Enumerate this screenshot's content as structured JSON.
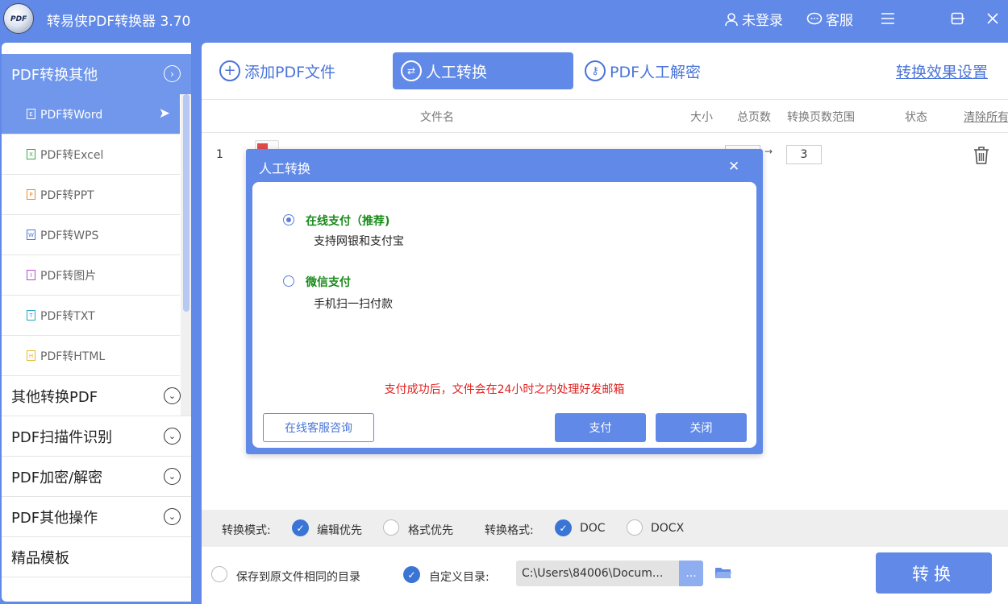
{
  "app": {
    "title": "转易侠PDF转换器 3.70",
    "logo_text": "PDF"
  },
  "titlebar": {
    "user_label": "未登录",
    "service_label": "客服"
  },
  "sidebar": {
    "header": "PDF转换其他",
    "sub_items": [
      {
        "label": "PDF转Word",
        "icon_color": "#6189e8",
        "icon_char": "E"
      },
      {
        "label": "PDF转Excel",
        "icon_color": "#3aa64a",
        "icon_char": "X"
      },
      {
        "label": "PDF转PPT",
        "icon_color": "#e88a2b",
        "icon_char": "P"
      },
      {
        "label": "PDF转WPS",
        "icon_color": "#4a74d8",
        "icon_char": "W"
      },
      {
        "label": "PDF转图片",
        "icon_color": "#b04fc4",
        "icon_char": "I"
      },
      {
        "label": "PDF转TXT",
        "icon_color": "#2aa3c8",
        "icon_char": "T"
      },
      {
        "label": "PDF转HTML",
        "icon_color": "#e8b830",
        "icon_char": "H"
      }
    ],
    "categories": [
      "其他转换PDF",
      "PDF扫描件识别",
      "PDF加密/解密",
      "PDF其他操作",
      "精品模板"
    ]
  },
  "toolbar": {
    "add_pdf": "添加PDF文件",
    "manual_convert": "人工转换",
    "manual_decrypt": "PDF人工解密",
    "settings": "转换效果设置"
  },
  "table": {
    "headers": {
      "filename": "文件名",
      "size": "大小",
      "pages": "总页数",
      "range": "转换页数范围",
      "status": "状态",
      "clear": "清除所有"
    },
    "rows": [
      {
        "index": "1",
        "range_end": "3"
      }
    ]
  },
  "options": {
    "mode_label": "转换模式:",
    "mode_edit": "编辑优先",
    "mode_format": "格式优先",
    "format_label": "转换格式:",
    "format_doc": "DOC",
    "format_docx": "DOCX"
  },
  "output": {
    "same_dir": "保存到原文件相同的目录",
    "custom_dir": "自定义目录:",
    "path": "C:\\Users\\84006\\Docum...",
    "browse": "...",
    "convert": "转换"
  },
  "modal": {
    "title": "人工转换",
    "option1": "在线支付（推荐)",
    "option1_desc": "支持网银和支付宝",
    "option2": "微信支付",
    "option2_desc": "手机扫一扫付款",
    "note": "支付成功后，文件会在24小时之内处理好发邮箱",
    "consult": "在线客服咨询",
    "pay": "支付",
    "close": "关闭"
  }
}
